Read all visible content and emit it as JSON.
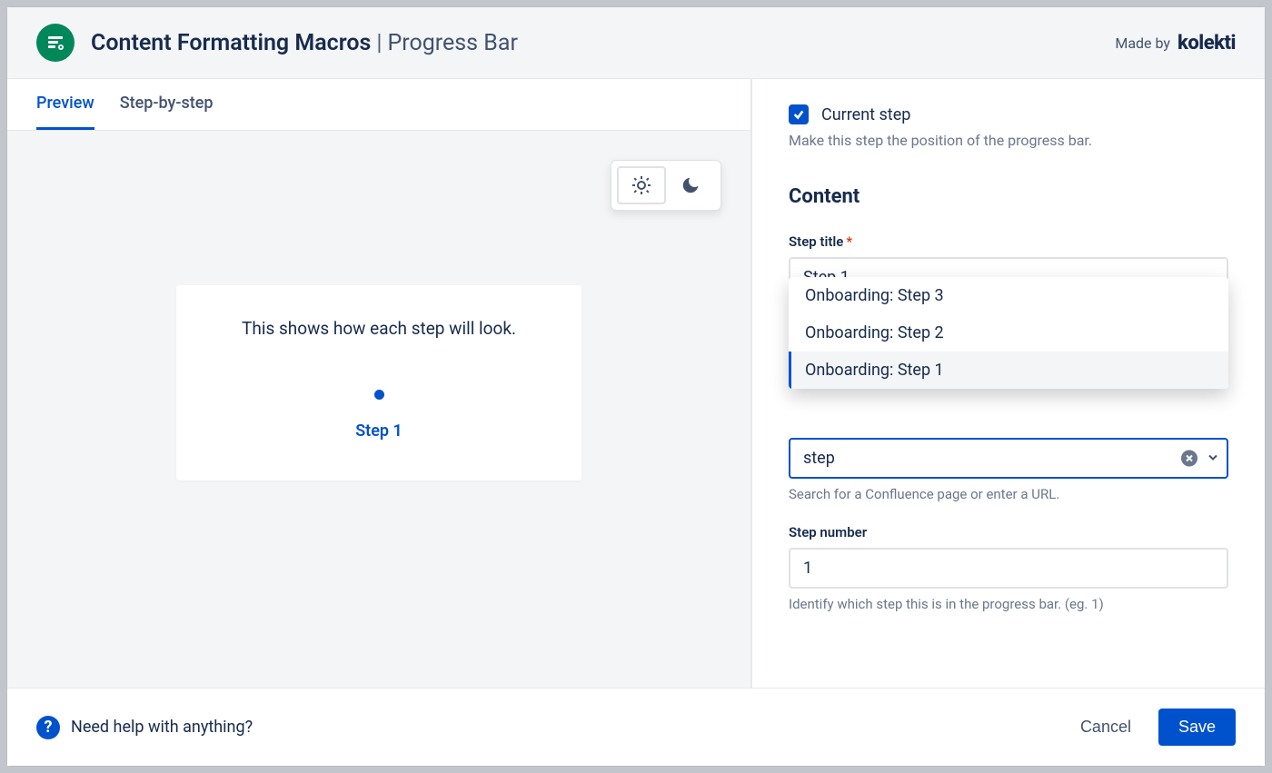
{
  "header": {
    "app_name": "Content Formatting Macros",
    "page_name": "Progress Bar",
    "made_by_label": "Made by",
    "brand": "kolekti"
  },
  "tabs": {
    "preview": "Preview",
    "step_by_step": "Step-by-step"
  },
  "preview": {
    "description": "This shows how each step will look.",
    "step_label": "Step 1"
  },
  "form": {
    "current_step": {
      "label": "Current step",
      "help": "Make this step the position of the progress bar.",
      "checked": true
    },
    "content_heading": "Content",
    "step_title": {
      "label": "Step title",
      "value": "Step 1",
      "options": [
        "Onboarding: Step 3",
        "Onboarding: Step 2",
        "Onboarding: Step 1"
      ],
      "highlighted_index": 2
    },
    "destination": {
      "value": "step",
      "help": "Search for a Confluence page or enter a URL."
    },
    "step_number": {
      "label": "Step number",
      "value": "1",
      "help": "Identify which step this is in the progress bar. (eg. 1)"
    }
  },
  "footer": {
    "help_text": "Need help with anything?",
    "cancel": "Cancel",
    "save": "Save"
  }
}
